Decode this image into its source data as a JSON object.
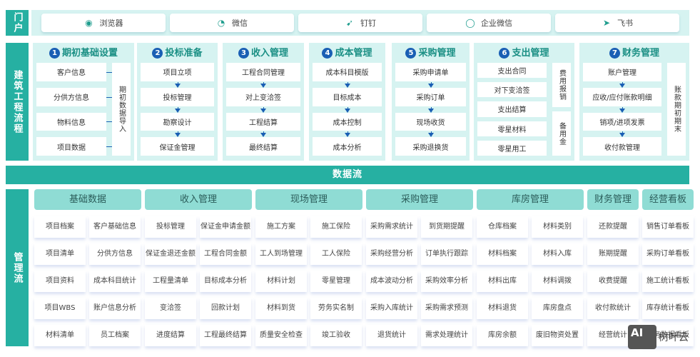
{
  "portal": {
    "label": "门户",
    "items": [
      {
        "label": "浏览器",
        "icon": "chrome-icon"
      },
      {
        "label": "微信",
        "icon": "wechat-icon"
      },
      {
        "label": "钉钉",
        "icon": "dingtalk-icon"
      },
      {
        "label": "企业微信",
        "icon": "wecom-icon"
      },
      {
        "label": "飞书",
        "icon": "feishu-icon"
      }
    ]
  },
  "flow": {
    "label": "建筑工程流程",
    "panels": [
      {
        "num": "1",
        "title": "期初基础设置",
        "items": [
          "客户信息",
          "分供方信息",
          "物料信息",
          "项目数据"
        ],
        "side": "期初数据导入"
      },
      {
        "num": "2",
        "title": "投标准备",
        "items": [
          "项目立项",
          "投标管理",
          "勘察设计",
          "保证金管理"
        ]
      },
      {
        "num": "3",
        "title": "收入管理",
        "items": [
          "工程合同管理",
          "对上变洽签",
          "工程结算",
          "最终结算"
        ]
      },
      {
        "num": "4",
        "title": "成本管理",
        "items": [
          "成本科目模版",
          "目标成本",
          "成本控制",
          "成本分析"
        ]
      },
      {
        "num": "5",
        "title": "采购管理",
        "items": [
          "采购申请单",
          "采购订单",
          "现场收货",
          "采购退换货"
        ]
      },
      {
        "num": "6",
        "title": "支出管理",
        "items": [
          "支出合同",
          "对下变洽签",
          "支出结算",
          "零星材料",
          "零星用工"
        ],
        "side": "费用报销",
        "side2": "备用金"
      },
      {
        "num": "7",
        "title": "财务管理",
        "items": [
          "账户管理",
          "应收/应付账款明细",
          "销项/进项发票",
          "收付款管理"
        ],
        "side": "账款期初期末"
      }
    ]
  },
  "stream": "数据流",
  "management": {
    "label": "管理流",
    "groups": [
      {
        "title": "基础数据",
        "cols": [
          [
            "项目档案",
            "项目清单",
            "项目资料",
            "项目WBS",
            "材料清单"
          ],
          [
            "客户基础信息",
            "分供方信息",
            "成本科目统计",
            "账户信息分析",
            "员工档案"
          ]
        ]
      },
      {
        "title": "收入管理",
        "cols": [
          [
            "投标管理",
            "保证金退还金额",
            "工程量清单",
            "变洽签",
            "进度结算"
          ],
          [
            "保证金申请金额",
            "工程合同金额",
            "目标成本分析",
            "回款计划",
            "工程最终结算"
          ]
        ]
      },
      {
        "title": "现场管理",
        "cols": [
          [
            "施工方案",
            "工人到场管理",
            "材料计划",
            "材料到货",
            "质量安全检查"
          ],
          [
            "施工保险",
            "工人保险",
            "零星管理",
            "劳务实名制",
            "竣工验收"
          ]
        ]
      },
      {
        "title": "采购管理",
        "cols": [
          [
            "采购需求统计",
            "采购经营分析",
            "成本波动分析",
            "采购入库统计",
            "退货统计"
          ],
          [
            "到货期提醒",
            "订单执行跟踪",
            "采购效率分析",
            "采购需求预测",
            "需求处理统计"
          ]
        ]
      },
      {
        "title": "库房管理",
        "cols": [
          [
            "仓库档案",
            "材料档案",
            "材料出库",
            "材料退货",
            "库房余额"
          ],
          [
            "材料类别",
            "材料入库",
            "材料调拨",
            "库房盘点",
            "废旧物资处置"
          ]
        ]
      },
      {
        "title": "财务管理",
        "cols": [
          [
            "还款提醒",
            "账期提醒",
            "收费提醒",
            "收付款统计",
            "经营统计"
          ]
        ]
      },
      {
        "title": "经营看板",
        "cols": [
          [
            "销售订单看板",
            "采购订单看板",
            "施工统计看板",
            "库存统计看板",
            "财务数据看板"
          ]
        ]
      }
    ]
  },
  "watermark": {
    "logo": "AI",
    "text": "树叶云"
  }
}
